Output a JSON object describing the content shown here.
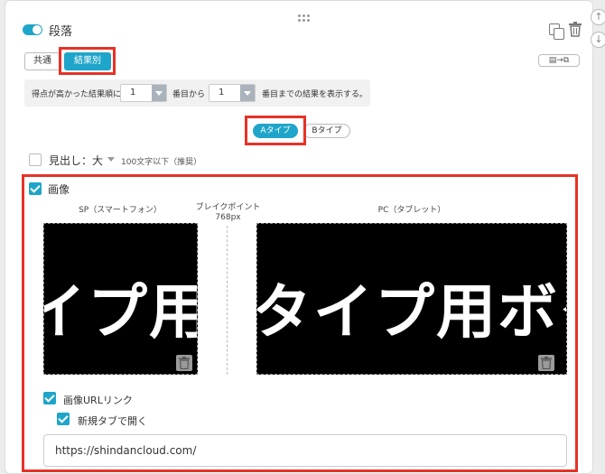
{
  "section": {
    "title": "段落",
    "toggle_on": true
  },
  "tabs": [
    {
      "label": "共通",
      "active": false
    },
    {
      "label": "結果別",
      "active": true
    }
  ],
  "swap_button_icon": "layout-swap-icon",
  "range": {
    "prefix": "得点が高かった結果順に",
    "from_value": "1",
    "middle": "番目から",
    "to_value": "1",
    "suffix": "番目までの結果を表示する。"
  },
  "types": [
    {
      "label": "Aタイプ",
      "active": true
    },
    {
      "label": "Bタイプ",
      "active": false
    }
  ],
  "heading": {
    "checked": false,
    "label": "見出し：大",
    "hint": "100文字以下（推奨）"
  },
  "image_section": {
    "checked": true,
    "label": "画像",
    "sp_label": "SP（スマートフォン）",
    "pc_label": "PC（タブレット）",
    "breakpoint_label": "ブレイクポイント",
    "breakpoint_value": "768px",
    "sp_image_text": "イプ用ボ",
    "pc_image_text": "タイプ用ボタ"
  },
  "link": {
    "checked": true,
    "label": "画像URLリンク",
    "new_tab_checked": true,
    "new_tab_label": "新規タブで開く",
    "url_value": "https://shindancloud.com/"
  },
  "colors": {
    "accent": "#1fa5c9",
    "highlight": "#e63226"
  }
}
